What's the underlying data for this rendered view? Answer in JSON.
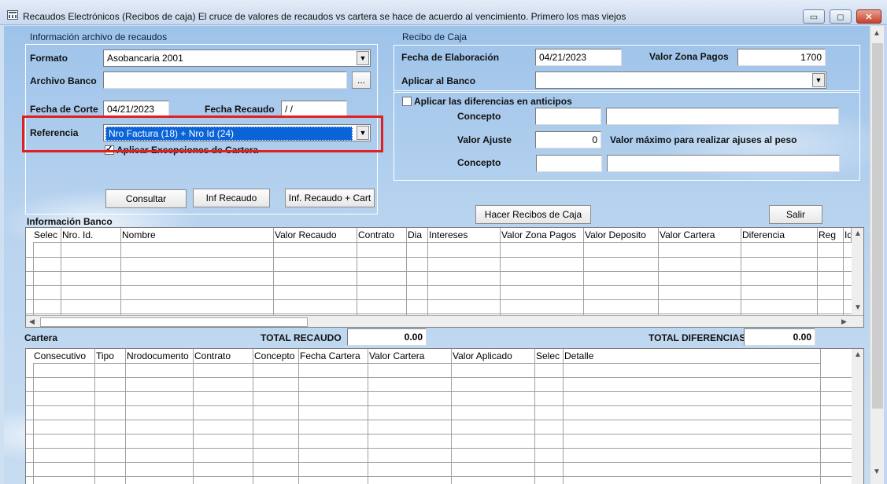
{
  "window": {
    "title": "Recaudos Electrónicos (Recibos de caja) El  cruce de valores de recaudos vs cartera se hace de acuerdo al vencimiento. Primero los mas viejos",
    "min_glyph": "▭",
    "max_glyph": "◻",
    "close_glyph": "✕"
  },
  "info_recaudos": {
    "title": "Información archivo de recaudos",
    "formato_label": "Formato",
    "formato_value": "Asobancaria 2001",
    "archivo_label": "Archivo Banco",
    "archivo_value": "",
    "browse_label": "...",
    "fecha_corte_label": "Fecha de Corte",
    "fecha_corte_value": "04/21/2023",
    "fecha_recaudo_label": "Fecha Recaudo",
    "fecha_recaudo_value": " / /",
    "referencia_label": "Referencia",
    "referencia_value": "Nro Factura (18) + Nro Id (24)",
    "excepciones_label": "Aplicar Excepciones de Cartera",
    "excepciones_checked": true,
    "check_glyph": "✓",
    "consultar_label": "Consultar",
    "inf_recaudo_label": "Inf Recaudo",
    "inf_recaudo_cart_label": "Inf. Recaudo + Cart"
  },
  "recibo": {
    "title": "Recibo de Caja",
    "fecha_elab_label": "Fecha de Elaboración",
    "fecha_elab_value": "04/21/2023",
    "valor_zona_label": "Valor Zona Pagos",
    "valor_zona_value": "1700",
    "aplicar_banco_label": "Aplicar al Banco",
    "aplicar_banco_value": "",
    "diferencias_label": "Aplicar las diferencias en anticipos",
    "diferencias_checked": false,
    "concepto1_label": "Concepto",
    "concepto1_code": "",
    "concepto1_desc": "",
    "valor_ajuste_label": "Valor Ajuste",
    "valor_ajuste_value": "0",
    "valor_max_label": "Valor máximo para realizar ajuses al peso",
    "concepto2_label": "Concepto",
    "concepto2_code": "",
    "concepto2_desc": ""
  },
  "actions": {
    "hacer_recibos_label": "Hacer Recibos de Caja",
    "salir_label": "Salir"
  },
  "banco_grid": {
    "title": "Información Banco",
    "columns": [
      "Selec",
      "Nro. Id.",
      "Nombre",
      "Valor Recaudo",
      "Contrato",
      "Dia",
      "Intereses",
      "Valor Zona Pagos",
      "Valor Deposito",
      "Valor Cartera",
      "Diferencia",
      "Reg",
      "Id"
    ]
  },
  "totals": {
    "cartera_label": "Cartera",
    "total_recaudo_label": "TOTAL RECAUDO",
    "total_recaudo_value": "0.00",
    "total_diferencias_label": "TOTAL DIFERENCIAS",
    "total_diferencias_value": "0.00"
  },
  "cartera_grid": {
    "columns": [
      "Consecutivo",
      "Tipo",
      "Nrodocumento",
      "Contrato",
      "Concepto",
      "Fecha Cartera",
      "Valor Cartera",
      "Valor Aplicado",
      "Selec",
      "Detalle"
    ]
  },
  "scroll": {
    "up": "▲",
    "down": "▼",
    "left": "◀",
    "right": "▶"
  },
  "highlight_color": "#e02020",
  "selection_color": "#0a64d8"
}
